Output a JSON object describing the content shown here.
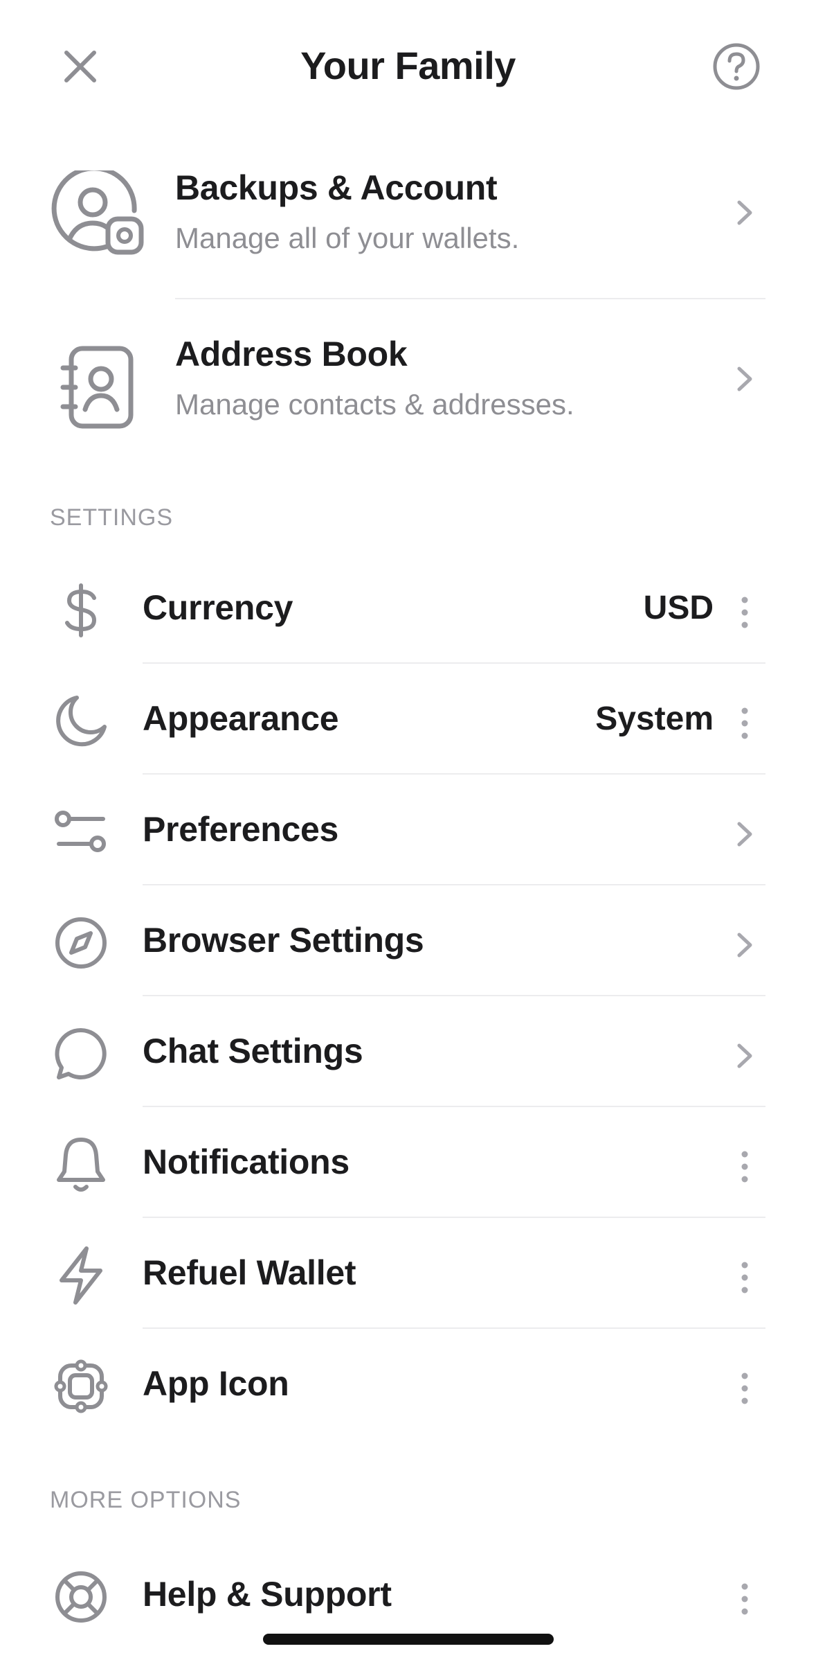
{
  "header": {
    "title": "Your Family",
    "close_icon": "close-icon",
    "help_icon": "question-mark-circle-icon"
  },
  "cards": [
    {
      "title": "Backups & Account",
      "subtitle": "Manage all of your wallets.",
      "icon": "user-gear-icon"
    },
    {
      "title": "Address Book",
      "subtitle": "Manage contacts & addresses.",
      "icon": "contact-book-icon"
    }
  ],
  "sections": {
    "settings_label": "SETTINGS",
    "more_label": "MORE OPTIONS"
  },
  "settings": [
    {
      "label": "Currency",
      "value": "USD",
      "icon": "dollar-icon",
      "action": "more-icon"
    },
    {
      "label": "Appearance",
      "value": "System",
      "icon": "moon-icon",
      "action": "more-icon"
    },
    {
      "label": "Preferences",
      "icon": "sliders-icon",
      "action": "chevron-right-icon"
    },
    {
      "label": "Browser Settings",
      "icon": "compass-icon",
      "action": "chevron-right-icon"
    },
    {
      "label": "Chat Settings",
      "icon": "chat-bubble-icon",
      "action": "chevron-right-icon"
    },
    {
      "label": "Notifications",
      "icon": "bell-icon",
      "action": "more-icon"
    },
    {
      "label": "Refuel Wallet",
      "icon": "lightning-icon",
      "action": "more-icon"
    },
    {
      "label": "App Icon",
      "icon": "app-icon-icon",
      "action": "more-icon"
    }
  ],
  "more_options": [
    {
      "label": "Help & Support",
      "icon": "lifebuoy-icon",
      "action": "more-icon"
    }
  ],
  "colors": {
    "text": "#1c1c1e",
    "secondary": "#8e8e93",
    "icon": "#8e8e93",
    "divider": "#ececee"
  }
}
